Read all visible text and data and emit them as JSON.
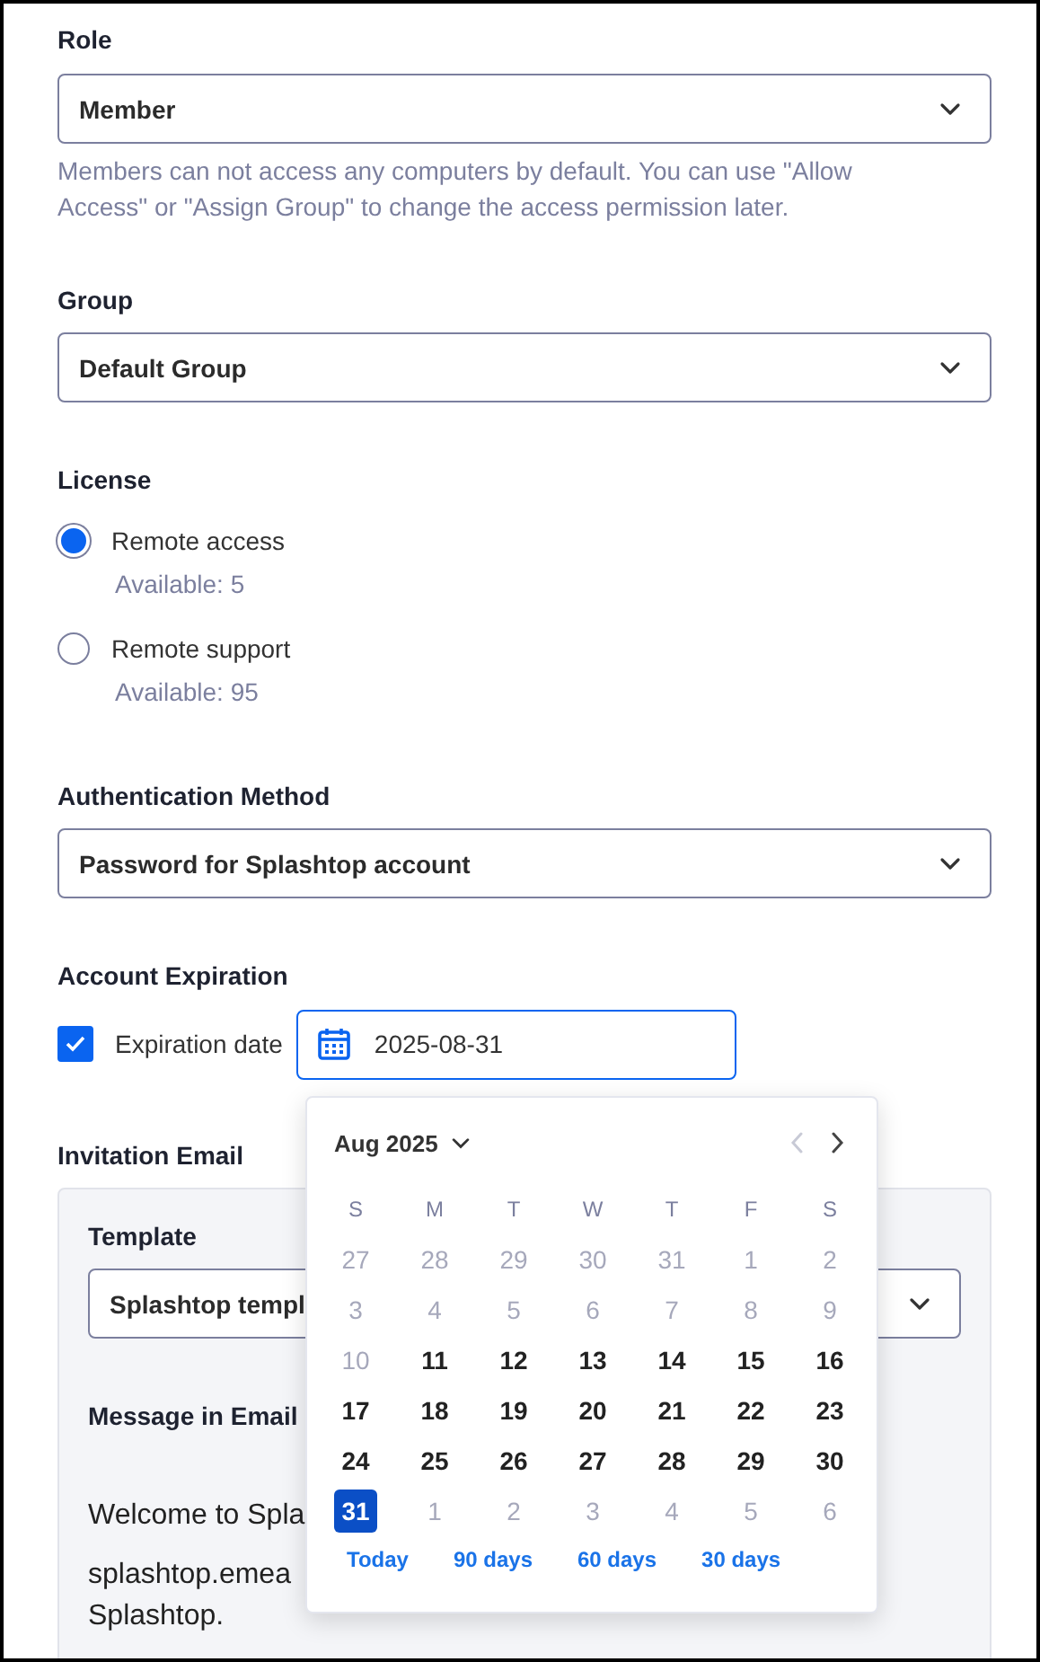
{
  "role": {
    "label": "Role",
    "value": "Member",
    "help": "Members can not access any computers by default. You can use \"Allow Access\" or \"Assign Group\" to change the access permission later."
  },
  "group": {
    "label": "Group",
    "value": "Default Group"
  },
  "license": {
    "label": "License",
    "options": [
      {
        "label": "Remote access",
        "available": "Available: 5",
        "selected": true
      },
      {
        "label": "Remote support",
        "available": "Available: 95",
        "selected": false
      }
    ]
  },
  "authentication": {
    "label": "Authentication Method",
    "value": "Password for Splashtop account"
  },
  "expiration": {
    "label": "Account Expiration",
    "checkbox_label": "Expiration date",
    "checked": true,
    "date": "2025-08-31"
  },
  "invitation": {
    "label": "Invitation Email",
    "template_label": "Template",
    "template_value": "Splashtop templ",
    "message_label": "Message in Email",
    "message_lines": [
      "Welcome to Spla",
      "splashtop.emea",
      "Splashtop."
    ]
  },
  "date_picker": {
    "month": "Aug 2025",
    "prev_disabled": true,
    "weekdays": [
      "S",
      "M",
      "T",
      "W",
      "T",
      "F",
      "S"
    ],
    "days": [
      {
        "label": "27",
        "muted": true,
        "selected": false
      },
      {
        "label": "28",
        "muted": true,
        "selected": false
      },
      {
        "label": "29",
        "muted": true,
        "selected": false
      },
      {
        "label": "30",
        "muted": true,
        "selected": false
      },
      {
        "label": "31",
        "muted": true,
        "selected": false
      },
      {
        "label": "1",
        "muted": true,
        "selected": false
      },
      {
        "label": "2",
        "muted": true,
        "selected": false
      },
      {
        "label": "3",
        "muted": true,
        "selected": false
      },
      {
        "label": "4",
        "muted": true,
        "selected": false
      },
      {
        "label": "5",
        "muted": true,
        "selected": false
      },
      {
        "label": "6",
        "muted": true,
        "selected": false
      },
      {
        "label": "7",
        "muted": true,
        "selected": false
      },
      {
        "label": "8",
        "muted": true,
        "selected": false
      },
      {
        "label": "9",
        "muted": true,
        "selected": false
      },
      {
        "label": "10",
        "muted": true,
        "selected": false
      },
      {
        "label": "11",
        "muted": false,
        "selected": false
      },
      {
        "label": "12",
        "muted": false,
        "selected": false
      },
      {
        "label": "13",
        "muted": false,
        "selected": false
      },
      {
        "label": "14",
        "muted": false,
        "selected": false
      },
      {
        "label": "15",
        "muted": false,
        "selected": false
      },
      {
        "label": "16",
        "muted": false,
        "selected": false
      },
      {
        "label": "17",
        "muted": false,
        "selected": false
      },
      {
        "label": "18",
        "muted": false,
        "selected": false
      },
      {
        "label": "19",
        "muted": false,
        "selected": false
      },
      {
        "label": "20",
        "muted": false,
        "selected": false
      },
      {
        "label": "21",
        "muted": false,
        "selected": false
      },
      {
        "label": "22",
        "muted": false,
        "selected": false
      },
      {
        "label": "23",
        "muted": false,
        "selected": false
      },
      {
        "label": "24",
        "muted": false,
        "selected": false
      },
      {
        "label": "25",
        "muted": false,
        "selected": false
      },
      {
        "label": "26",
        "muted": false,
        "selected": false
      },
      {
        "label": "27",
        "muted": false,
        "selected": false
      },
      {
        "label": "28",
        "muted": false,
        "selected": false
      },
      {
        "label": "29",
        "muted": false,
        "selected": false
      },
      {
        "label": "30",
        "muted": false,
        "selected": false
      },
      {
        "label": "31",
        "muted": false,
        "selected": true
      },
      {
        "label": "1",
        "muted": true,
        "selected": false
      },
      {
        "label": "2",
        "muted": true,
        "selected": false
      },
      {
        "label": "3",
        "muted": true,
        "selected": false
      },
      {
        "label": "4",
        "muted": true,
        "selected": false
      },
      {
        "label": "5",
        "muted": true,
        "selected": false
      },
      {
        "label": "6",
        "muted": true,
        "selected": false
      }
    ],
    "shortcuts": [
      "Today",
      "90 days",
      "60 days",
      "30 days"
    ]
  }
}
